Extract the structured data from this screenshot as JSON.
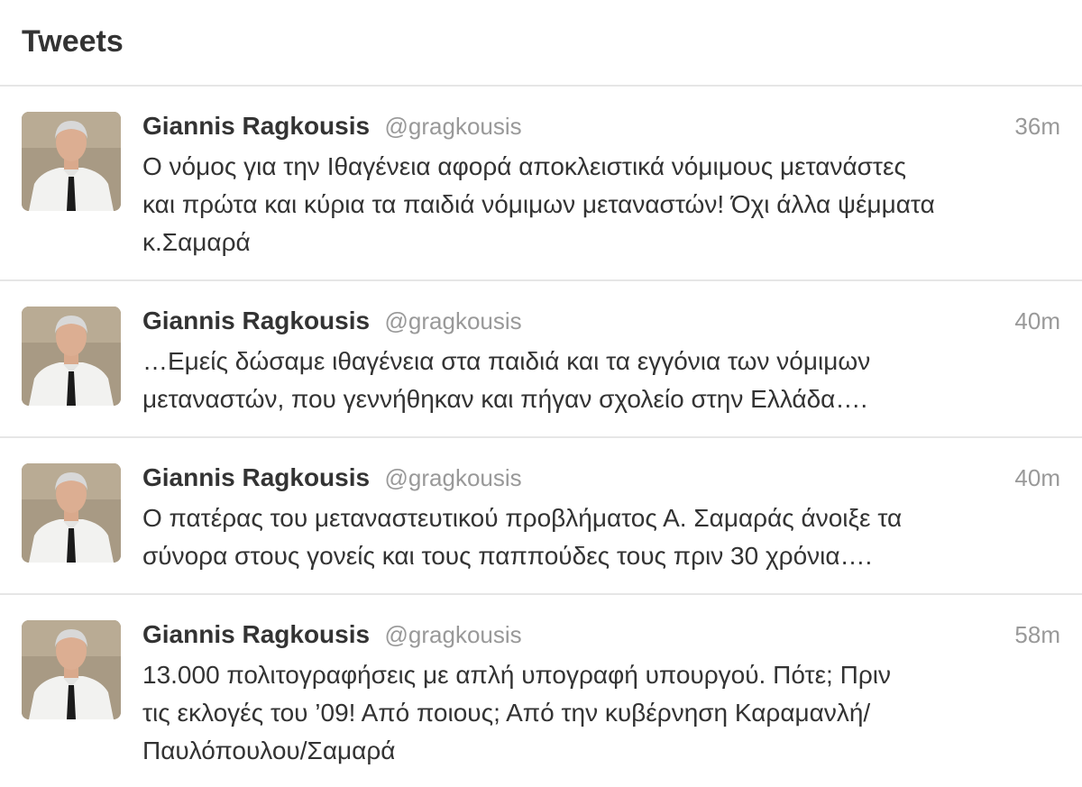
{
  "stream": {
    "title": "Tweets"
  },
  "tweets": [
    {
      "fullname": "Giannis Ragkousis",
      "username": "@gragkousis",
      "time": "36m",
      "text": "Ο νόμος για την Ιθαγένεια αφορά αποκλειστικά νόμιμους μετανάστες\nκαι πρώτα και κύρια τα παιδιά νόμιμων μεταναστών! Όχι άλλα ψέμματα\nκ.Σαμαρά"
    },
    {
      "fullname": "Giannis Ragkousis",
      "username": "@gragkousis",
      "time": "40m",
      "text": "…Εμείς δώσαμε ιθαγένεια στα παιδιά και τα εγγόνια των νόμιμων\nμεταναστών, που γεννήθηκαν και πήγαν σχολείο στην Ελλάδα…."
    },
    {
      "fullname": "Giannis Ragkousis",
      "username": "@gragkousis",
      "time": "40m",
      "text": "Ο πατέρας του μεταναστευτικού προβλήματος Α. Σαμαράς άνοιξε τα\nσύνορα στους γονείς και τους παππούδες τους πριν 30 χρόνια…."
    },
    {
      "fullname": "Giannis Ragkousis",
      "username": "@gragkousis",
      "time": "58m",
      "text": "13.000 πολιτογραφήσεις με απλή υπογραφή υπουργού. Πότε; Πριν\nτις εκλογές του ’09! Από ποιους; Από την κυβέρνηση Καραμανλή/\nΠαυλόπουλου/Σαμαρά"
    }
  ],
  "colors": {
    "text": "#333333",
    "muted": "#999999",
    "divider": "#e6e6e6",
    "avatar_bg": "#a89a84"
  },
  "icons": {
    "avatar": "profile-photo"
  }
}
